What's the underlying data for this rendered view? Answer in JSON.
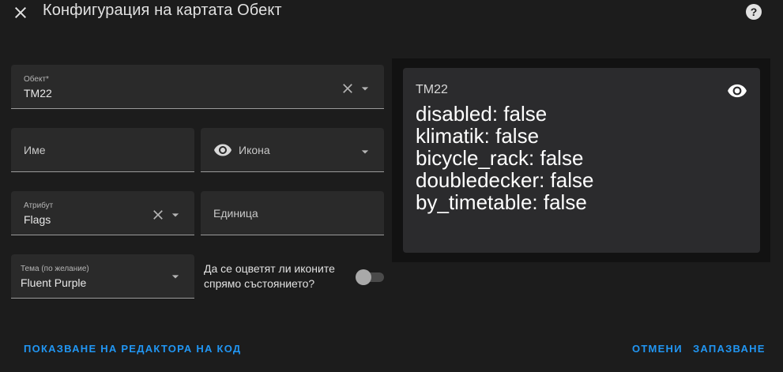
{
  "header": {
    "title": "Конфигурация на картата Обект"
  },
  "form": {
    "entity": {
      "label": "Обект*",
      "value": "TM22"
    },
    "name": {
      "placeholder": "Име"
    },
    "icon": {
      "placeholder": "Икона"
    },
    "attribute": {
      "label": "Атрибут",
      "value": "Flags"
    },
    "unit": {
      "placeholder": "Единица"
    },
    "theme": {
      "label": "Тема (по желание)",
      "value": "Fluent Purple"
    },
    "state_color": {
      "label": "Да се оцветят ли иконите спрямо състоянието?",
      "checked": false
    }
  },
  "preview": {
    "name": "TM22",
    "state_lines": [
      "disabled: false",
      "klimatik: false",
      "bicycle_rack: false",
      "doubledecker: false",
      "by_timetable: false"
    ]
  },
  "footer": {
    "show_code_editor": "ПОКАЗВАНЕ НА РЕДАКТОРА НА КОД",
    "cancel": "ОТМЕНИ",
    "save": "ЗАПАЗВАНЕ"
  },
  "colors": {
    "background": "#1c1c1c",
    "field": "#2a2a2a",
    "accent": "#2196f3",
    "card": "#2b2b2d"
  },
  "icons": {
    "close": "close-icon",
    "help": "help-circle-icon",
    "clear": "clear-icon",
    "dropdown": "chevron-down-icon",
    "eye": "eye-icon"
  }
}
